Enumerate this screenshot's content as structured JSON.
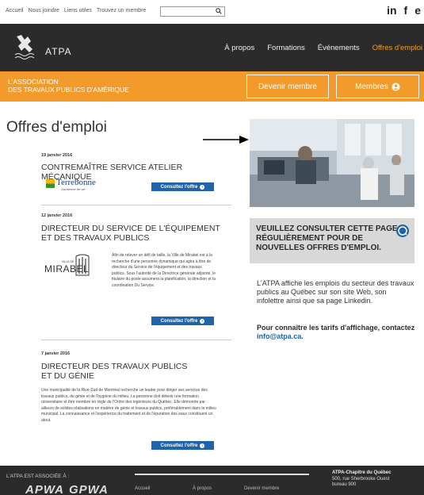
{
  "topbar": {
    "links": [
      "Accueil",
      "Nous joindre",
      "Liens utiles",
      "Trouvez un membre"
    ],
    "search_placeholder": "",
    "search_icon": "search-icon",
    "social": [
      "in",
      "f",
      "e"
    ]
  },
  "nav": {
    "logo_text": "ATPA",
    "links": [
      "À propos",
      "Formations",
      "Événements",
      "Offres d'emploi"
    ],
    "active_index": 3
  },
  "orange": {
    "assoc_line1": "L'ASSOCIATION",
    "assoc_line2": "DES TRAVAUX PUBLICS D'AMÉRIQUE",
    "devenir": "Devenir membre",
    "membres": "Membres"
  },
  "page": {
    "title": "Offres d'emploi"
  },
  "jobs": [
    {
      "date": "19 janvier 2016",
      "title": "CONTREMAÎTRE SERVICE ATELIER MÉCANIQUE",
      "logo": "Terrebonne",
      "logo_sub": "Gardienne de vie",
      "button": "Consultez l'offre"
    },
    {
      "date": "12 janvier 2016",
      "title_line1": "DIRECTEUR DU SERVICE DE L'ÉQUIPEMENT",
      "title_line2": "ET DES TRAVAUX PUBLICS",
      "logo": "MIRABEL",
      "logo_sub": "VILLE DE",
      "body": "Afin de relever un défi de taille, la Ville de Mirabel est à la recherche d'une personne dynamique qui agira à titre de directeur du Service de l'équipement et des travaux publics. Sous l'autorité de la Directrice générale adjointe, le titulaire du poste assumera la planification, la direction et la coordination Du Service.",
      "button": "Consultez l'offre"
    },
    {
      "date": "7 janvier 2016",
      "title_line1": "DIRECTEUR DES TRAVAUX PUBLICS",
      "title_line2": "ET DU GÉNIE",
      "body": "Une municipalité de la Rive-Sud de Montréal recherche un leader pour diriger ses services des travaux publics, du génie et de l'hygiène du milieu. La personne doit détenir une formation universitaire et être membre en règle de l'Ordre des ingénieurs du Québec. Elle démontre par ailleurs de solides réalisations en matière de génie et travaux publics, préférablement dans le milieu municipal. La connaissance et l'expérience du traitement et de l'épuration des eaux constituent un atout.",
      "button": "Consultez l'offre"
    }
  ],
  "sidebar": {
    "notice": "VEUILLEZ CONSULTER CETTE PAGE RÉGULIÈREMENT POUR DE NOUVELLES OFFRES D'EMPLOI.",
    "info": "L'ATPA affiche les emplois du secteur des travaux publics au Québec sur son site Web, son infolettre ainsi que sa page Linkedin.",
    "tarifs_prefix": "Pour connaître les tarifs d'affichage, contactez ",
    "email": "info@atpa.ca",
    "tarifs_suffix": "."
  },
  "footer": {
    "assoc": "L'ATPA EST ASSOCIÉE À :",
    "apwa": "APWA",
    "gpwa": "GPWA",
    "links": [
      "Accueil",
      "À propos",
      "Devenir membre"
    ],
    "chapter_title": "ATPA-Chapitre du Québec",
    "chapter_addr1": "500, rue Sherbrooke Ouest",
    "chapter_addr2": "bureau 900"
  },
  "colors": {
    "orange": "#f29a2a",
    "dark": "#2b2b2b",
    "blue": "#1f63a8"
  }
}
